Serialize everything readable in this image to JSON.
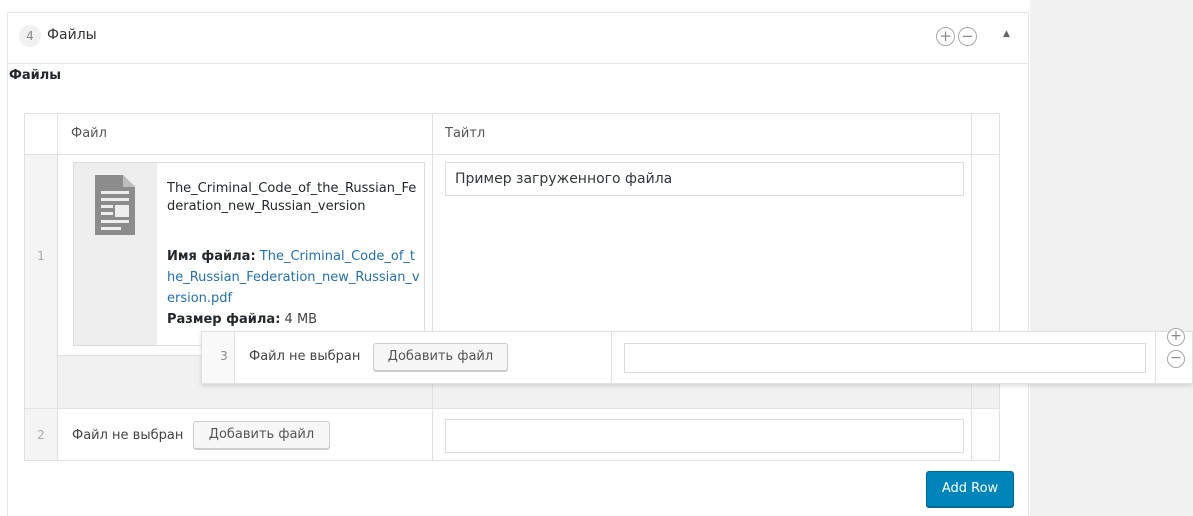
{
  "panel": {
    "number": "4",
    "title": "Файлы",
    "add_icon": "plus-circle-icon",
    "remove_icon": "minus-circle-icon",
    "collapse_icon": "caret-up-icon"
  },
  "section": {
    "label": "Файлы"
  },
  "table": {
    "columns": [
      "Файл",
      "Тайтл"
    ],
    "rows": [
      {
        "index": "1",
        "file": {
          "icon": "document-icon",
          "name": "The_Criminal_Code_of_the_Russian_Federation_new_Russian_version",
          "filename_label": "Имя файла:",
          "filename_value": "The_Criminal_Code_of_the_Russian_Federation_new_Russian_version.pdf",
          "size_label": "Размер файла:",
          "size_value": "4 MB"
        },
        "title_value": "Пример загруженного файла"
      },
      {
        "index": "2",
        "no_file_text": "Файл не выбран",
        "add_file_label": "Добавить файл",
        "title_value": ""
      }
    ]
  },
  "dragging_row": {
    "index": "3",
    "no_file_text": "Файл не выбран",
    "add_file_label": "Добавить файл",
    "title_value": "",
    "add_icon": "plus-circle-icon",
    "remove_icon": "minus-circle-icon"
  },
  "add_row_label": "Add Row",
  "colors": {
    "primary_button": "#0085ba",
    "link": "#2271b1"
  }
}
